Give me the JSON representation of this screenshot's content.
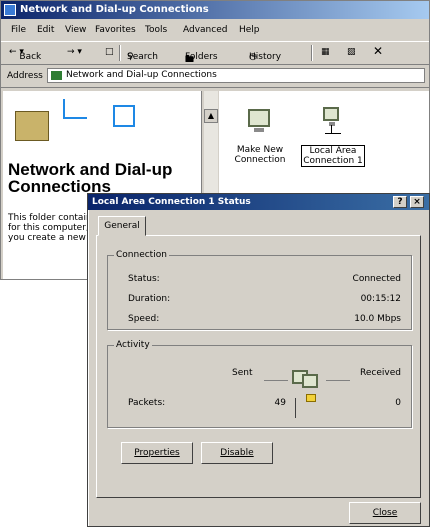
{
  "explorer": {
    "title": "Network and Dial-up Connections",
    "menu": [
      "File",
      "Edit",
      "View",
      "Favorites",
      "Tools",
      "Advanced",
      "Help"
    ],
    "toolbar": {
      "back": "Back",
      "search": "Search",
      "folders": "Folders",
      "history": "History"
    },
    "address": {
      "label": "Address",
      "value": "Network and Dial-up Connections"
    },
    "left_pane": {
      "title": "Network and Dial-up Connections",
      "description": "This folder contains network connections for this computer, and a wizard to help you create a new connection."
    },
    "icons": [
      {
        "label": "Make New Connection"
      },
      {
        "label": "Local Area Connection 1"
      }
    ]
  },
  "dialog": {
    "title": "Local Area Connection 1 Status",
    "help_btn": "?",
    "close_btn": "×",
    "tab": "General",
    "connection": {
      "legend": "Connection",
      "rows": [
        {
          "label": "Status:",
          "value": "Connected"
        },
        {
          "label": "Duration:",
          "value": "00:15:12"
        },
        {
          "label": "Speed:",
          "value": "10.0 Mbps"
        }
      ]
    },
    "activity": {
      "legend": "Activity",
      "sent_label": "Sent",
      "received_label": "Received",
      "packets_label": "Packets:",
      "packets_sent": "49",
      "packets_received": "0"
    },
    "buttons": {
      "properties": "Properties",
      "disable": "Disable",
      "close": "Close"
    }
  }
}
